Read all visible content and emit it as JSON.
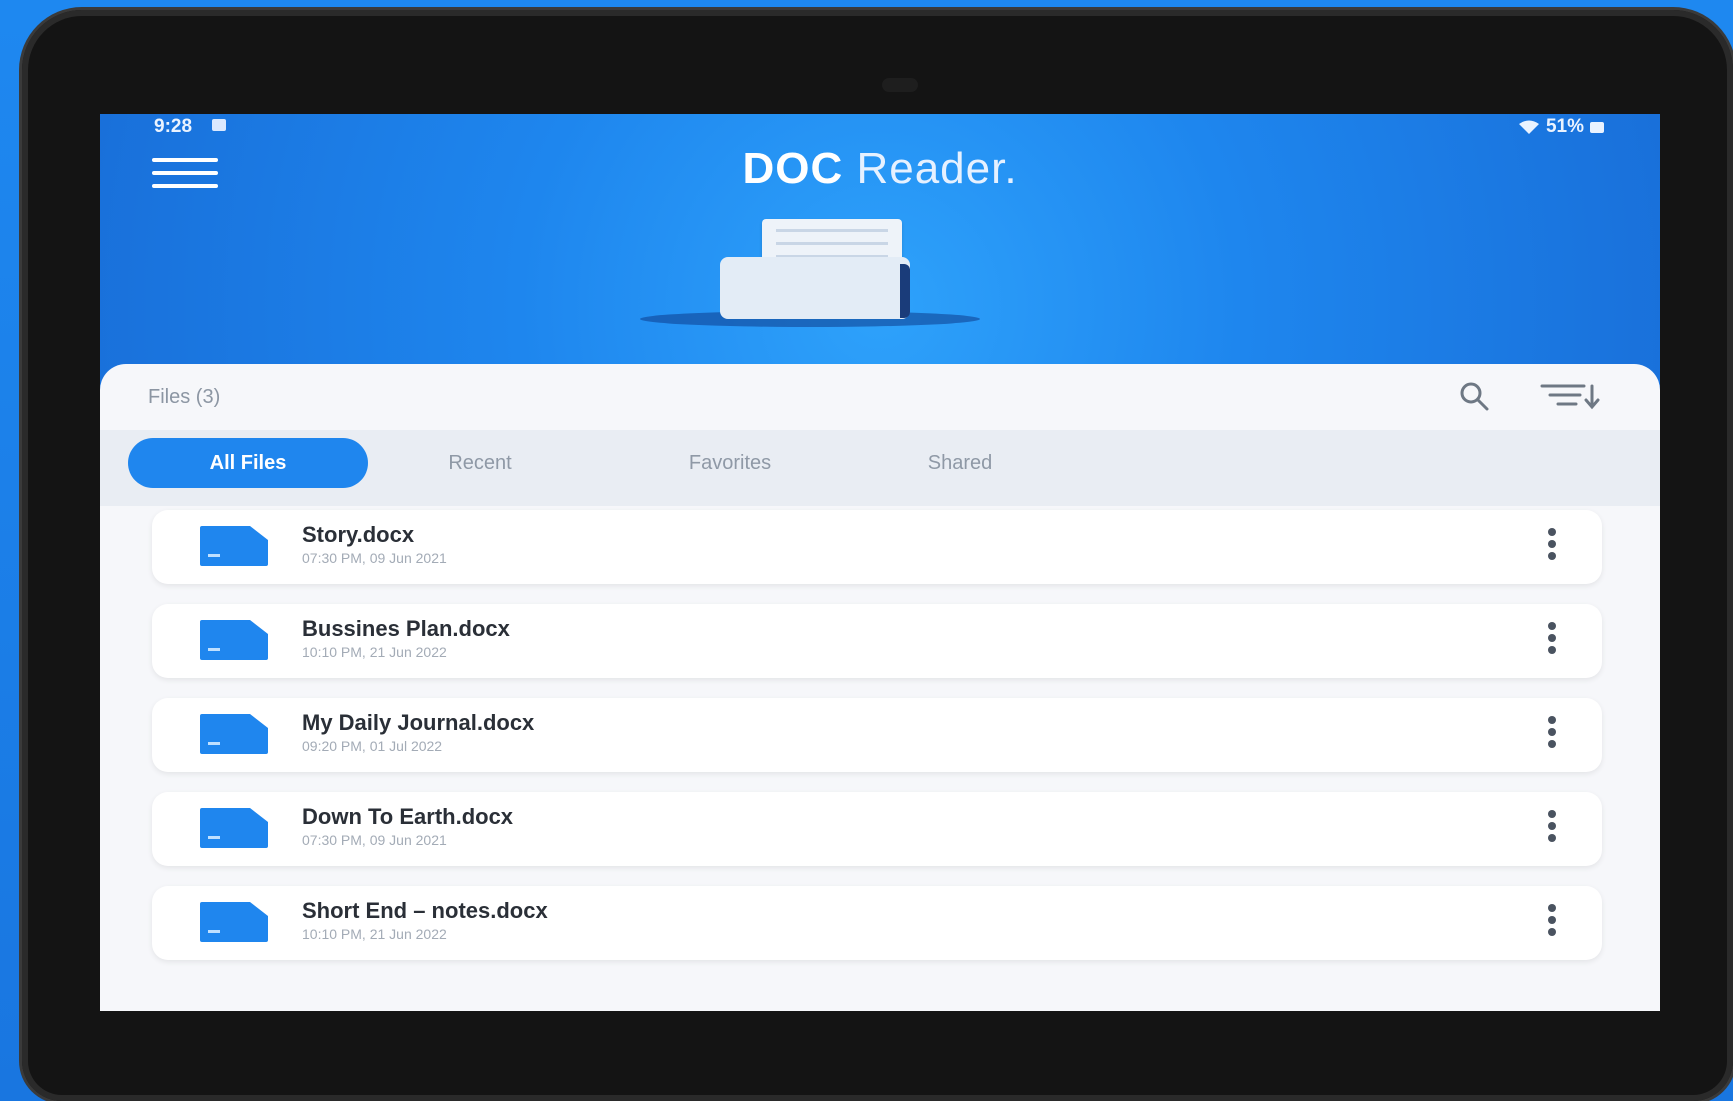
{
  "status_bar": {
    "time": "9:28",
    "battery": "51%"
  },
  "header": {
    "title_bold": "DOC",
    "title_rest": " Reader."
  },
  "files_header": {
    "count_label": "Files (3)"
  },
  "tabs": [
    {
      "label": "All Files",
      "active": true
    },
    {
      "label": "Recent",
      "active": false
    },
    {
      "label": "Favorites",
      "active": false
    },
    {
      "label": "Shared",
      "active": false
    }
  ],
  "files": [
    {
      "name": "Story.docx",
      "date": "07:30 PM, 09 Jun 2021"
    },
    {
      "name": "Bussines Plan.docx",
      "date": "10:10 PM, 21 Jun 2022"
    },
    {
      "name": "My Daily Journal.docx",
      "date": "09:20 PM, 01 Jul 2022"
    },
    {
      "name": "Down To Earth.docx",
      "date": "07:30 PM, 09 Jun 2021"
    },
    {
      "name": "Short End – notes.docx",
      "date": "10:10 PM, 21 Jun 2022"
    }
  ],
  "colors": {
    "accent": "#1f86ee",
    "background": "#1e88f0",
    "device": "#141414"
  }
}
